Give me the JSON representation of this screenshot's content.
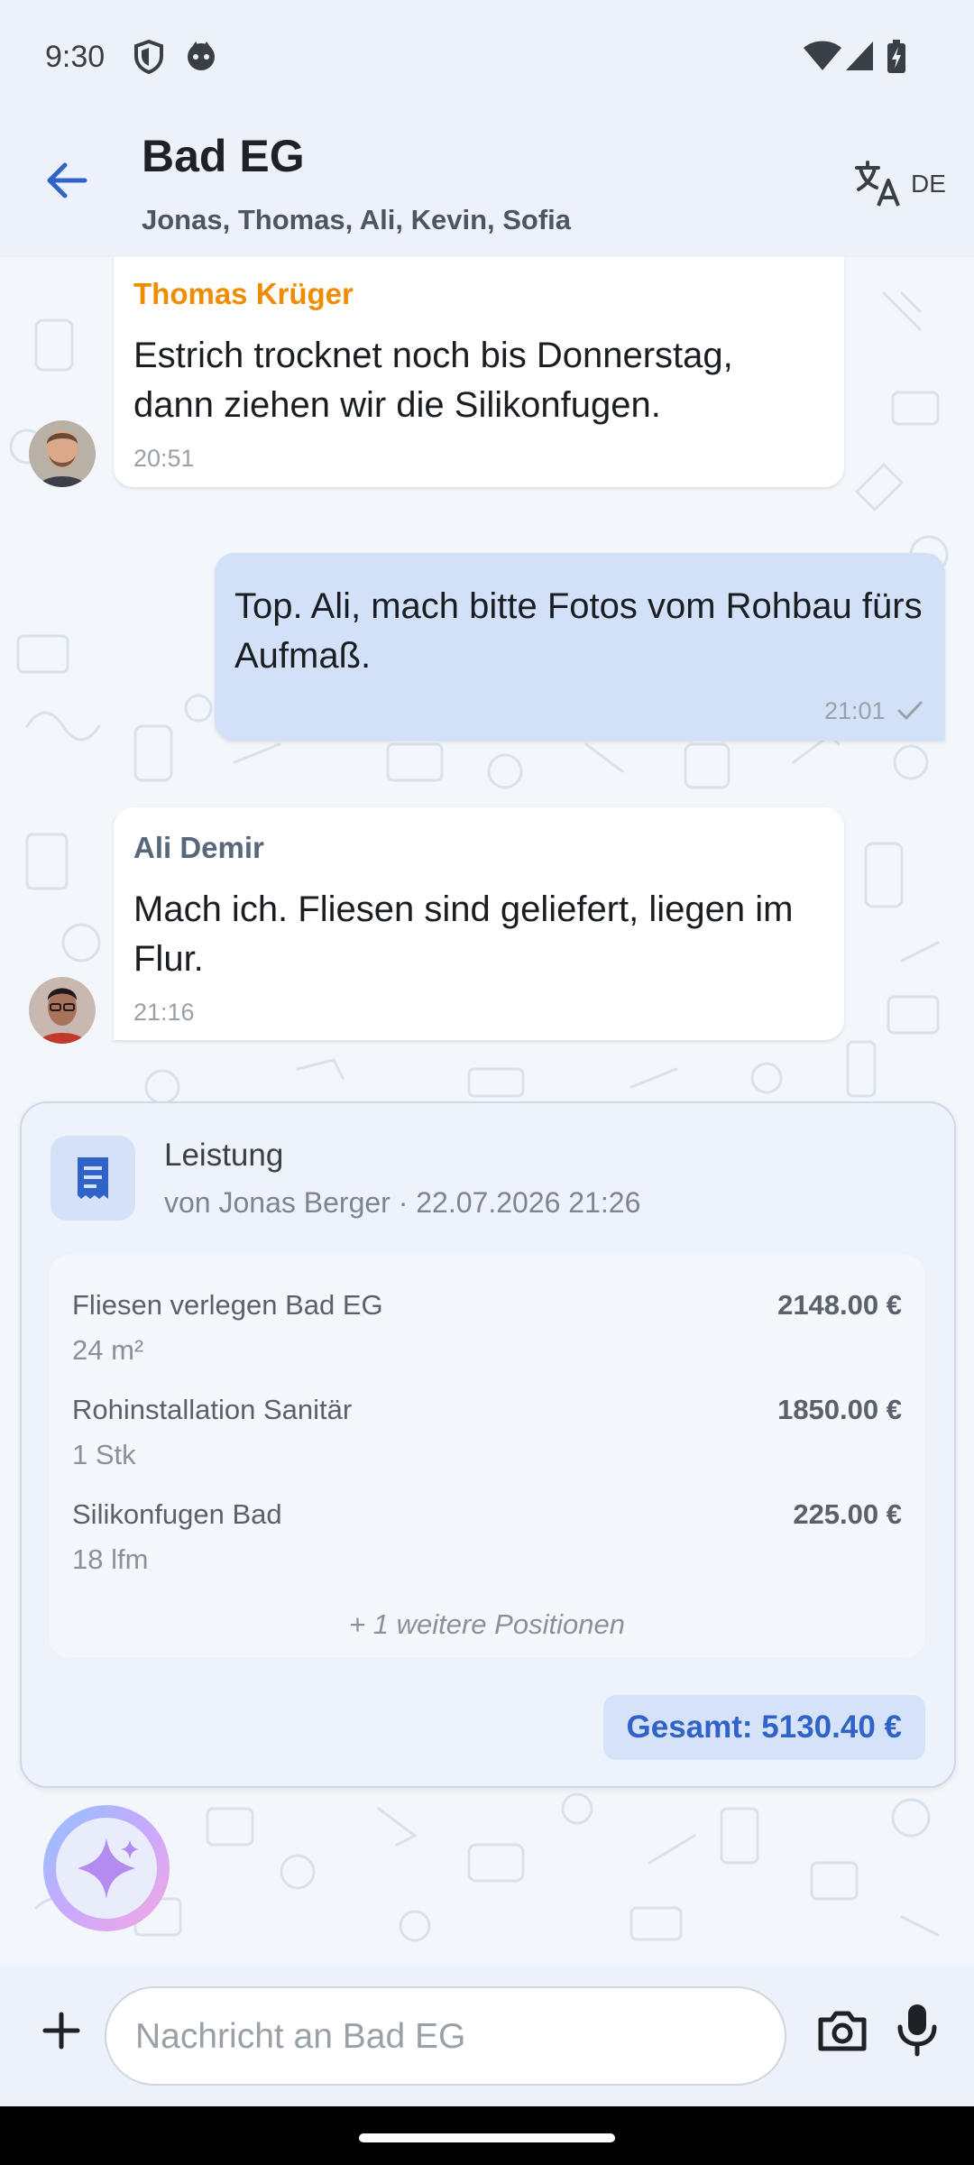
{
  "status_bar": {
    "time": "9:30"
  },
  "header": {
    "title": "Bad EG",
    "members": "Jonas, Thomas, Ali, Kevin, Sofia",
    "language": "DE"
  },
  "messages": [
    {
      "sender": "Thomas Krüger",
      "text": "Estrich trocknet noch bis Donnerstag, dann ziehen wir die Silikonfugen.",
      "time": "20:51",
      "sender_color": "#f08c00"
    },
    {
      "text": "Top. Ali, mach bitte Fotos vom Rohbau fürs Aufmaß.",
      "time": "21:01",
      "outgoing": true
    },
    {
      "sender": "Ali Demir",
      "text": "Mach ich. Fliesen sind geliefert, liegen im Flur.",
      "time": "21:16",
      "sender_color": "#58677a"
    }
  ],
  "service_card": {
    "title": "Leistung",
    "meta": "von Jonas Berger · 22.07.2026 21:26",
    "items": [
      {
        "name": "Fliesen verlegen Bad EG",
        "quantity": "24 m²",
        "price": "2148.00 €"
      },
      {
        "name": "Rohinstallation Sanitär",
        "quantity": "1 Stk",
        "price": "1850.00 €"
      },
      {
        "name": "Silikonfugen Bad",
        "quantity": "18 lfm",
        "price": "225.00 €"
      }
    ],
    "more": "+ 1 weitere Positionen",
    "total": "Gesamt: 5130.40 €"
  },
  "composer": {
    "placeholder": "Nachricht an Bad EG"
  },
  "colors": {
    "accent": "#2f63c9",
    "outgoing_bubble": "#d3e1f8",
    "background": "#edf2fa"
  }
}
